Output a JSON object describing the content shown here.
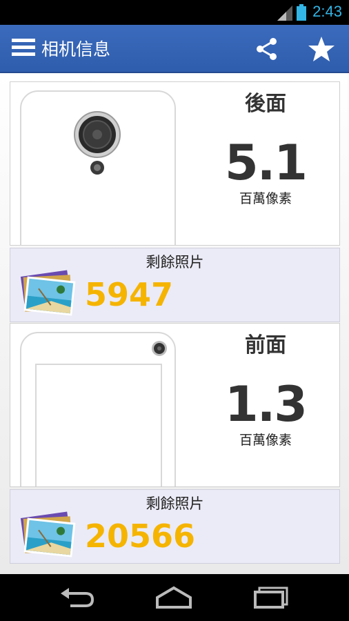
{
  "status": {
    "time": "2:43"
  },
  "header": {
    "title": "相机信息"
  },
  "cameras": [
    {
      "side": "後面",
      "megapixels": "5.1",
      "unit": "百萬像素",
      "photos_label": "剩餘照片",
      "photos_left": "5947"
    },
    {
      "side": "前面",
      "megapixels": "1.3",
      "unit": "百萬像素",
      "photos_label": "剩餘照片",
      "photos_left": "20566"
    }
  ],
  "colors": {
    "accent": "#33b5e5",
    "actionbar": "#3b6bbd",
    "count": "#f5b400"
  },
  "icons": {
    "menu": "menu-icon",
    "share": "share-icon",
    "favorite": "star-icon",
    "back": "back-icon",
    "home": "home-icon",
    "recents": "recents-icon"
  }
}
